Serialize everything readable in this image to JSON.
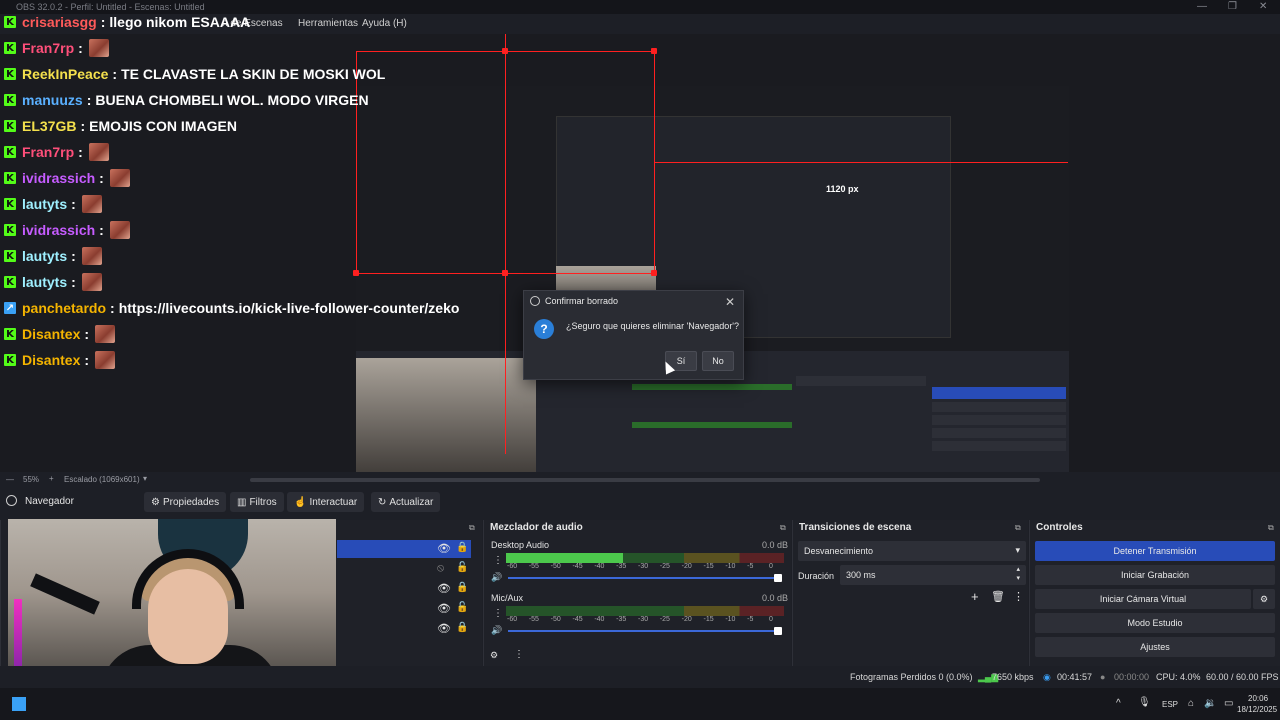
{
  "titlebar": {
    "text": "OBS 32.0.2 - Perfil: Untitled - Escenas: Untitled"
  },
  "menu": {
    "items": [
      "n de Escenas",
      "Herramientas",
      "Ayuda (H)"
    ]
  },
  "chat": [
    {
      "user": "crisariasgg",
      "msg": "llego nikom ESAAAA",
      "color": "#ff5a5a",
      "emote": false,
      "badge": "kick"
    },
    {
      "user": "Fran7rp",
      "msg": "",
      "color": "#ff4f7a",
      "emote": true,
      "badge": "kick"
    },
    {
      "user": "ReekInPeace",
      "msg": "TE CLAVASTE LA SKIN DE MOSKI WOL",
      "color": "#f4e04d",
      "emote": false,
      "badge": "kick"
    },
    {
      "user": "manuuzs",
      "msg": "BUENA CHOMBELI WOL. MODO VIRGEN",
      "color": "#5ab0ff",
      "emote": false,
      "badge": "kick"
    },
    {
      "user": "EL37GB",
      "msg": "EMOJIS CON IMAGEN",
      "color": "#f4e04d",
      "emote": false,
      "badge": "kick"
    },
    {
      "user": "Fran7rp",
      "msg": "",
      "color": "#ff4f7a",
      "emote": true,
      "badge": "kick"
    },
    {
      "user": "ividrassich",
      "msg": "",
      "color": "#c65cff",
      "emote": true,
      "badge": "kick"
    },
    {
      "user": "lautyts",
      "msg": "",
      "color": "#9ff0ff",
      "emote": true,
      "badge": "kick"
    },
    {
      "user": "ividrassich",
      "msg": "",
      "color": "#c65cff",
      "emote": true,
      "badge": "kick"
    },
    {
      "user": "lautyts",
      "msg": "",
      "color": "#9ff0ff",
      "emote": true,
      "badge": "kick"
    },
    {
      "user": "lautyts",
      "msg": "",
      "color": "#9ff0ff",
      "emote": true,
      "badge": "kick"
    },
    {
      "user": "panchetardo",
      "msg": "https://livecounts.io/kick-live-follower-counter/zeko",
      "color": "#f4b400",
      "emote": false,
      "badge": "kick-blue"
    },
    {
      "user": "Disantex",
      "msg": "",
      "color": "#f4b400",
      "emote": true,
      "badge": "kick"
    },
    {
      "user": "Disantex",
      "msg": "",
      "color": "#f4b400",
      "emote": true,
      "badge": "kick"
    }
  ],
  "preview_labels": {
    "px_label": "1120 px"
  },
  "dialog": {
    "title": "Confirmar borrado",
    "question": "¿Seguro que quieres eliminar 'Navegador'?",
    "yes": "Sí",
    "no": "No"
  },
  "zoombar": {
    "zoom": "55%",
    "plus": "+",
    "scale": "Escalado (1069x601)"
  },
  "source_toolbar": {
    "source_name": "Navegador",
    "props": "Propiedades",
    "filters": "Filtros",
    "interact": "Interactuar",
    "refresh": "Actualizar"
  },
  "mixer": {
    "title": "Mezclador de audio",
    "channels": [
      {
        "name": "Desktop Audio",
        "db": "0.0 dB",
        "level": 0.42
      },
      {
        "name": "Mic/Aux",
        "db": "0.0 dB",
        "level": 0
      }
    ],
    "ticks": [
      "-60",
      "-55",
      "-50",
      "-45",
      "-40",
      "-35",
      "-30",
      "-25",
      "-20",
      "-15",
      "-10",
      "-5",
      "0"
    ]
  },
  "transitions": {
    "title": "Transiciones de escena",
    "selected": "Desvanecimiento",
    "duration_label": "Duración",
    "duration_value": "300 ms"
  },
  "controls": {
    "title": "Controles",
    "stop_stream": "Detener Transmisión",
    "start_rec": "Iniciar Grabación",
    "virtual_cam": "Iniciar Cámara Virtual",
    "studio": "Modo Estudio",
    "settings": "Ajustes"
  },
  "status": {
    "dropped": "Fotogramas Perdidos 0 (0.0%)",
    "bitrate": "7650 kbps",
    "live_time": "00:41:57",
    "rec_time": "00:00:00",
    "cpu": "CPU: 4.0%",
    "fps": "60.00 / 60.00 FPS"
  },
  "taskbar": {
    "lang": "ESP",
    "time": "20:06",
    "date": "18/12/2025"
  },
  "colors": {
    "accent": "#284cb8",
    "kick_green": "#53fc18",
    "red_guides": "#ff2020"
  }
}
